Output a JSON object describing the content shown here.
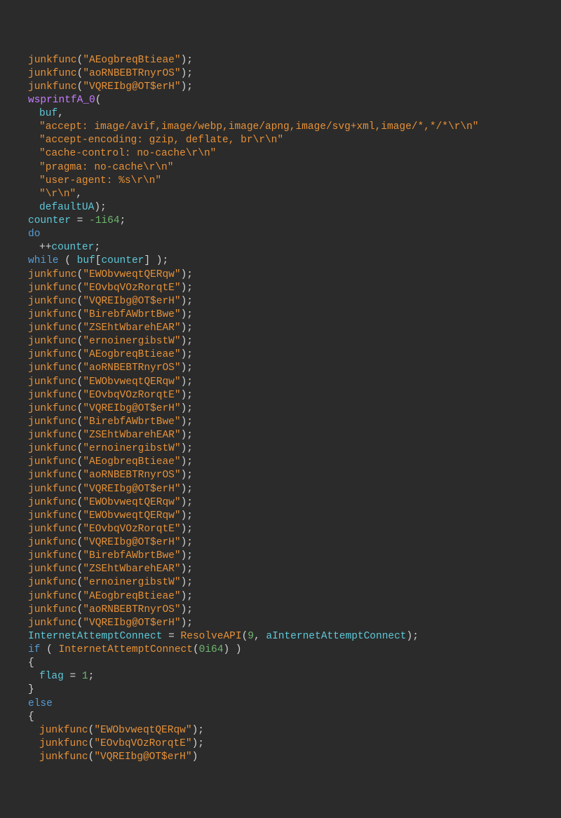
{
  "junk_fn": "junkfunc",
  "wsprintf_fn": "wsprintfA_0",
  "resolve_fn": "ResolveAPI",
  "iac_fn": "InternetAttemptConnect",
  "buf_var": "buf",
  "defaultUA_var": "defaultUA",
  "counter_var": "counter",
  "flag_var": "flag",
  "aIAC_var": "aInternetAttemptConnect",
  "neg1i64": "-1i64",
  "zeroi64": "0i64",
  "nine": "9",
  "one": "1",
  "kw": {
    "do": "do",
    "while": "while",
    "if": "if",
    "else": "else"
  },
  "http_lines": [
    "\"accept: image/avif,image/webp,image/apng,image/svg+xml,image/*,*/*\\r\\n\"",
    "\"accept-encoding: gzip, deflate, br\\r\\n\"",
    "\"cache-control: no-cache\\r\\n\"",
    "\"pragma: no-cache\\r\\n\"",
    "\"user-agent: %s\\r\\n\"",
    "\"\\r\\n\""
  ],
  "junk_block1": [
    "\"AEogbreqBtieae\"",
    "\"aoRNBEBTRnyrOS\"",
    "\"VQREIbg@OT$erH\""
  ],
  "junk_block2": [
    "\"EWObvweqtQERqw\"",
    "\"EOvbqVOzRorqtE\"",
    "\"VQREIbg@OT$erH\"",
    "\"BirebfAWbrtBwe\"",
    "\"ZSEhtWbarehEAR\"",
    "\"ernoinergibstW\"",
    "\"AEogbreqBtieae\"",
    "\"aoRNBEBTRnyrOS\"",
    "\"EWObvweqtQERqw\"",
    "\"EOvbqVOzRorqtE\"",
    "\"VQREIbg@OT$erH\"",
    "\"BirebfAWbrtBwe\"",
    "\"ZSEhtWbarehEAR\"",
    "\"ernoinergibstW\"",
    "\"AEogbreqBtieae\"",
    "\"aoRNBEBTRnyrOS\"",
    "\"VQREIbg@OT$erH\"",
    "\"EWObvweqtQERqw\"",
    "\"EWObvweqtQERqw\"",
    "\"EOvbqVOzRorqtE\"",
    "\"VQREIbg@OT$erH\"",
    "\"BirebfAWbrtBwe\"",
    "\"ZSEhtWbarehEAR\"",
    "\"ernoinergibstW\"",
    "\"AEogbreqBtieae\"",
    "\"aoRNBEBTRnyrOS\"",
    "\"VQREIbg@OT$erH\""
  ],
  "junk_block3": [
    "\"EWObvweqtQERqw\"",
    "\"EOvbqVOzRorqtE\"",
    "\"VQREIbg@OT$erH\""
  ]
}
